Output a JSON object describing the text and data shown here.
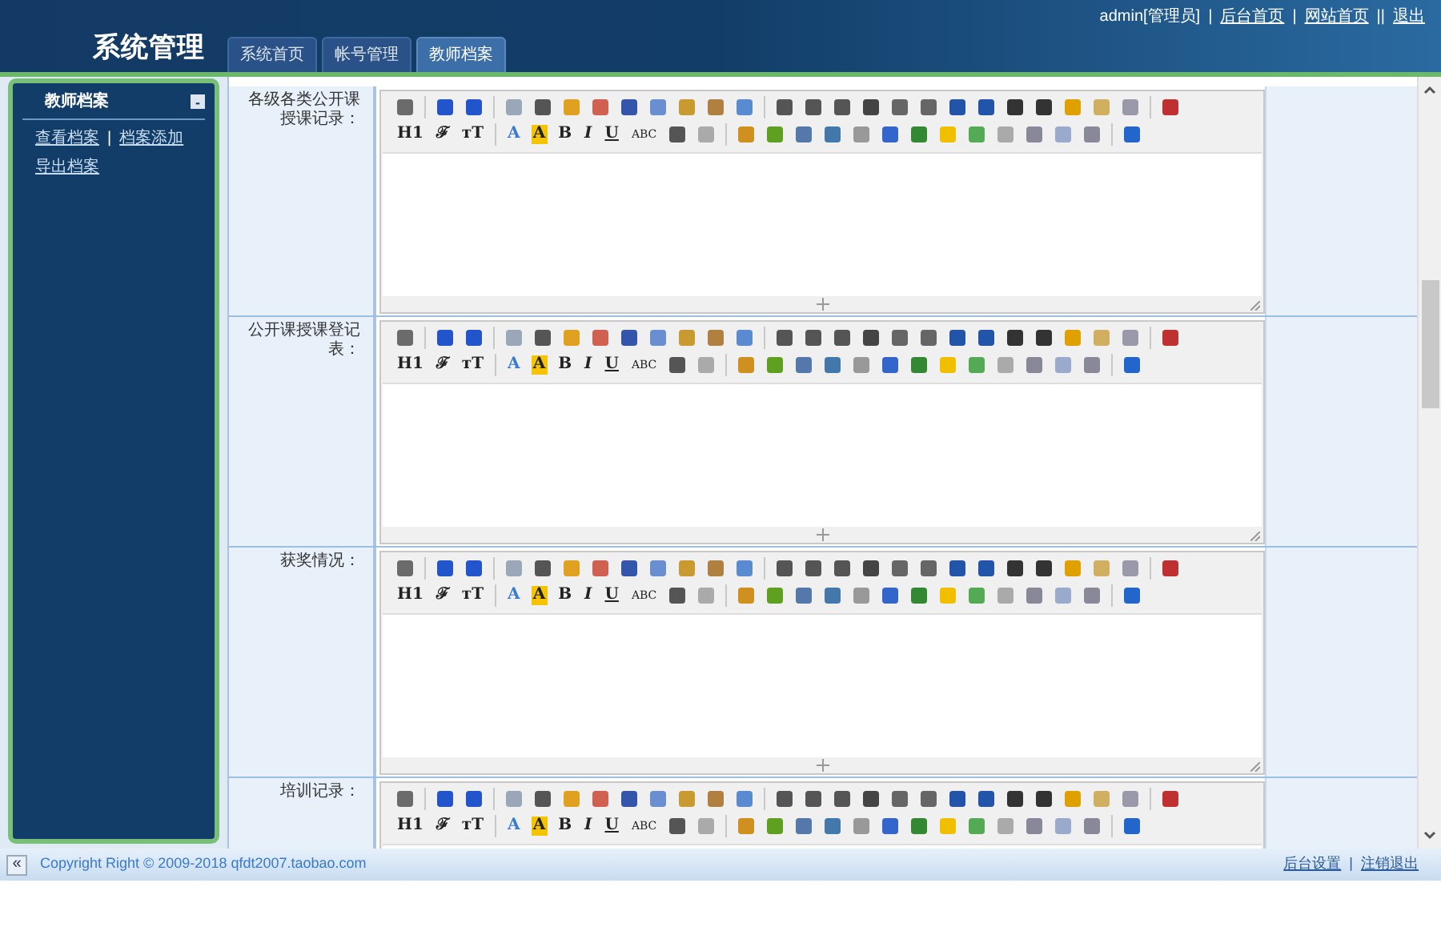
{
  "header": {
    "title": "系统管理",
    "tabs": [
      {
        "label": "系统首页",
        "selected": false
      },
      {
        "label": "帐号管理",
        "selected": false
      },
      {
        "label": "教师档案",
        "selected": true
      }
    ],
    "top_links": [
      {
        "text": "admin[管理员]",
        "kind": "text"
      },
      {
        "text": "|",
        "kind": "separator"
      },
      {
        "text": "后台首页",
        "kind": "link"
      },
      {
        "text": "|",
        "kind": "separator"
      },
      {
        "text": "网站首页",
        "kind": "link"
      },
      {
        "text": "||",
        "kind": "separator"
      },
      {
        "text": "退出",
        "kind": "link"
      }
    ]
  },
  "sidebar": {
    "title": "教师档案",
    "collapse_icon": "-",
    "items": [
      {
        "text": "查看档案",
        "kind": "link"
      },
      {
        "text": "|",
        "kind": "separator"
      },
      {
        "text": "档案添加",
        "kind": "link"
      },
      {
        "text": "导出档案",
        "kind": "link"
      }
    ]
  },
  "form_rows": [
    {
      "label": "各级各类公开课授课记录：",
      "toolbar_text": [
        "H1",
        "ℱ",
        "тT",
        "A",
        "A",
        "B",
        "I",
        "U",
        "ABC"
      ]
    },
    {
      "label": "公开课授课登记表：",
      "toolbar_text": [
        "H1",
        "ℱ",
        "тT",
        "A",
        "A",
        "B",
        "I",
        "U",
        "ABC"
      ]
    },
    {
      "label": "获奖情况：",
      "toolbar_text": [
        "H1",
        "ℱ",
        "тT",
        "A",
        "A",
        "B",
        "I",
        "U",
        "ABC"
      ]
    },
    {
      "label": "培训记录：",
      "toolbar_text": [
        "H1",
        "ℱ",
        "тT",
        "A",
        "A",
        "B",
        "I",
        "U",
        "ABC"
      ]
    }
  ],
  "footer": {
    "collapse_button": "«",
    "copyright": "Copyright Right © 2009-2018 qfdt2007.taobao.com",
    "links": [
      {
        "text": "后台设置",
        "kind": "link"
      },
      {
        "text": "|",
        "kind": "separator"
      },
      {
        "text": "注销退出",
        "kind": "link"
      }
    ]
  }
}
